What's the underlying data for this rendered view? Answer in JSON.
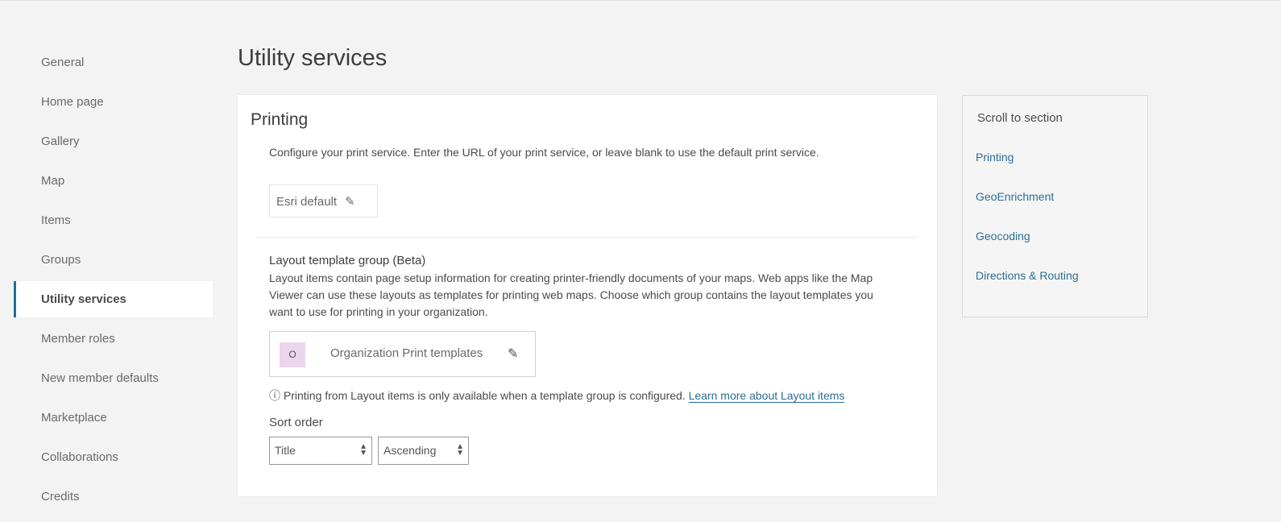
{
  "sidebar": {
    "items": [
      "General",
      "Home page",
      "Gallery",
      "Map",
      "Items",
      "Groups",
      "Utility services",
      "Member roles",
      "New member defaults",
      "Marketplace",
      "Collaborations",
      "Credits"
    ]
  },
  "page_title": "Utility services",
  "printing": {
    "title": "Printing",
    "description": "Configure your print service. Enter the URL of your print service, or leave blank to use the default print service.",
    "service_value": "Esri default",
    "layout_title": "Layout template group (Beta)",
    "layout_description": "Layout items contain page setup information for creating printer-friendly documents of your maps. Web apps like the Map Viewer can use these layouts as templates for printing web maps. Choose which group contains the layout templates you want to use for printing in your organization.",
    "group_initial": "O",
    "group_name": "Organization Print templates",
    "group_color": "#ecd6ec",
    "info_text": "Printing from Layout items is only available when a template group is configured.",
    "info_link": "Learn more about Layout items",
    "sort_label": "Sort order",
    "sort_field": "Title",
    "sort_direction": "Ascending"
  },
  "toc": {
    "title": "Scroll to section",
    "links": [
      "Printing",
      "GeoEnrichment",
      "Geocoding",
      "Directions & Routing"
    ]
  }
}
